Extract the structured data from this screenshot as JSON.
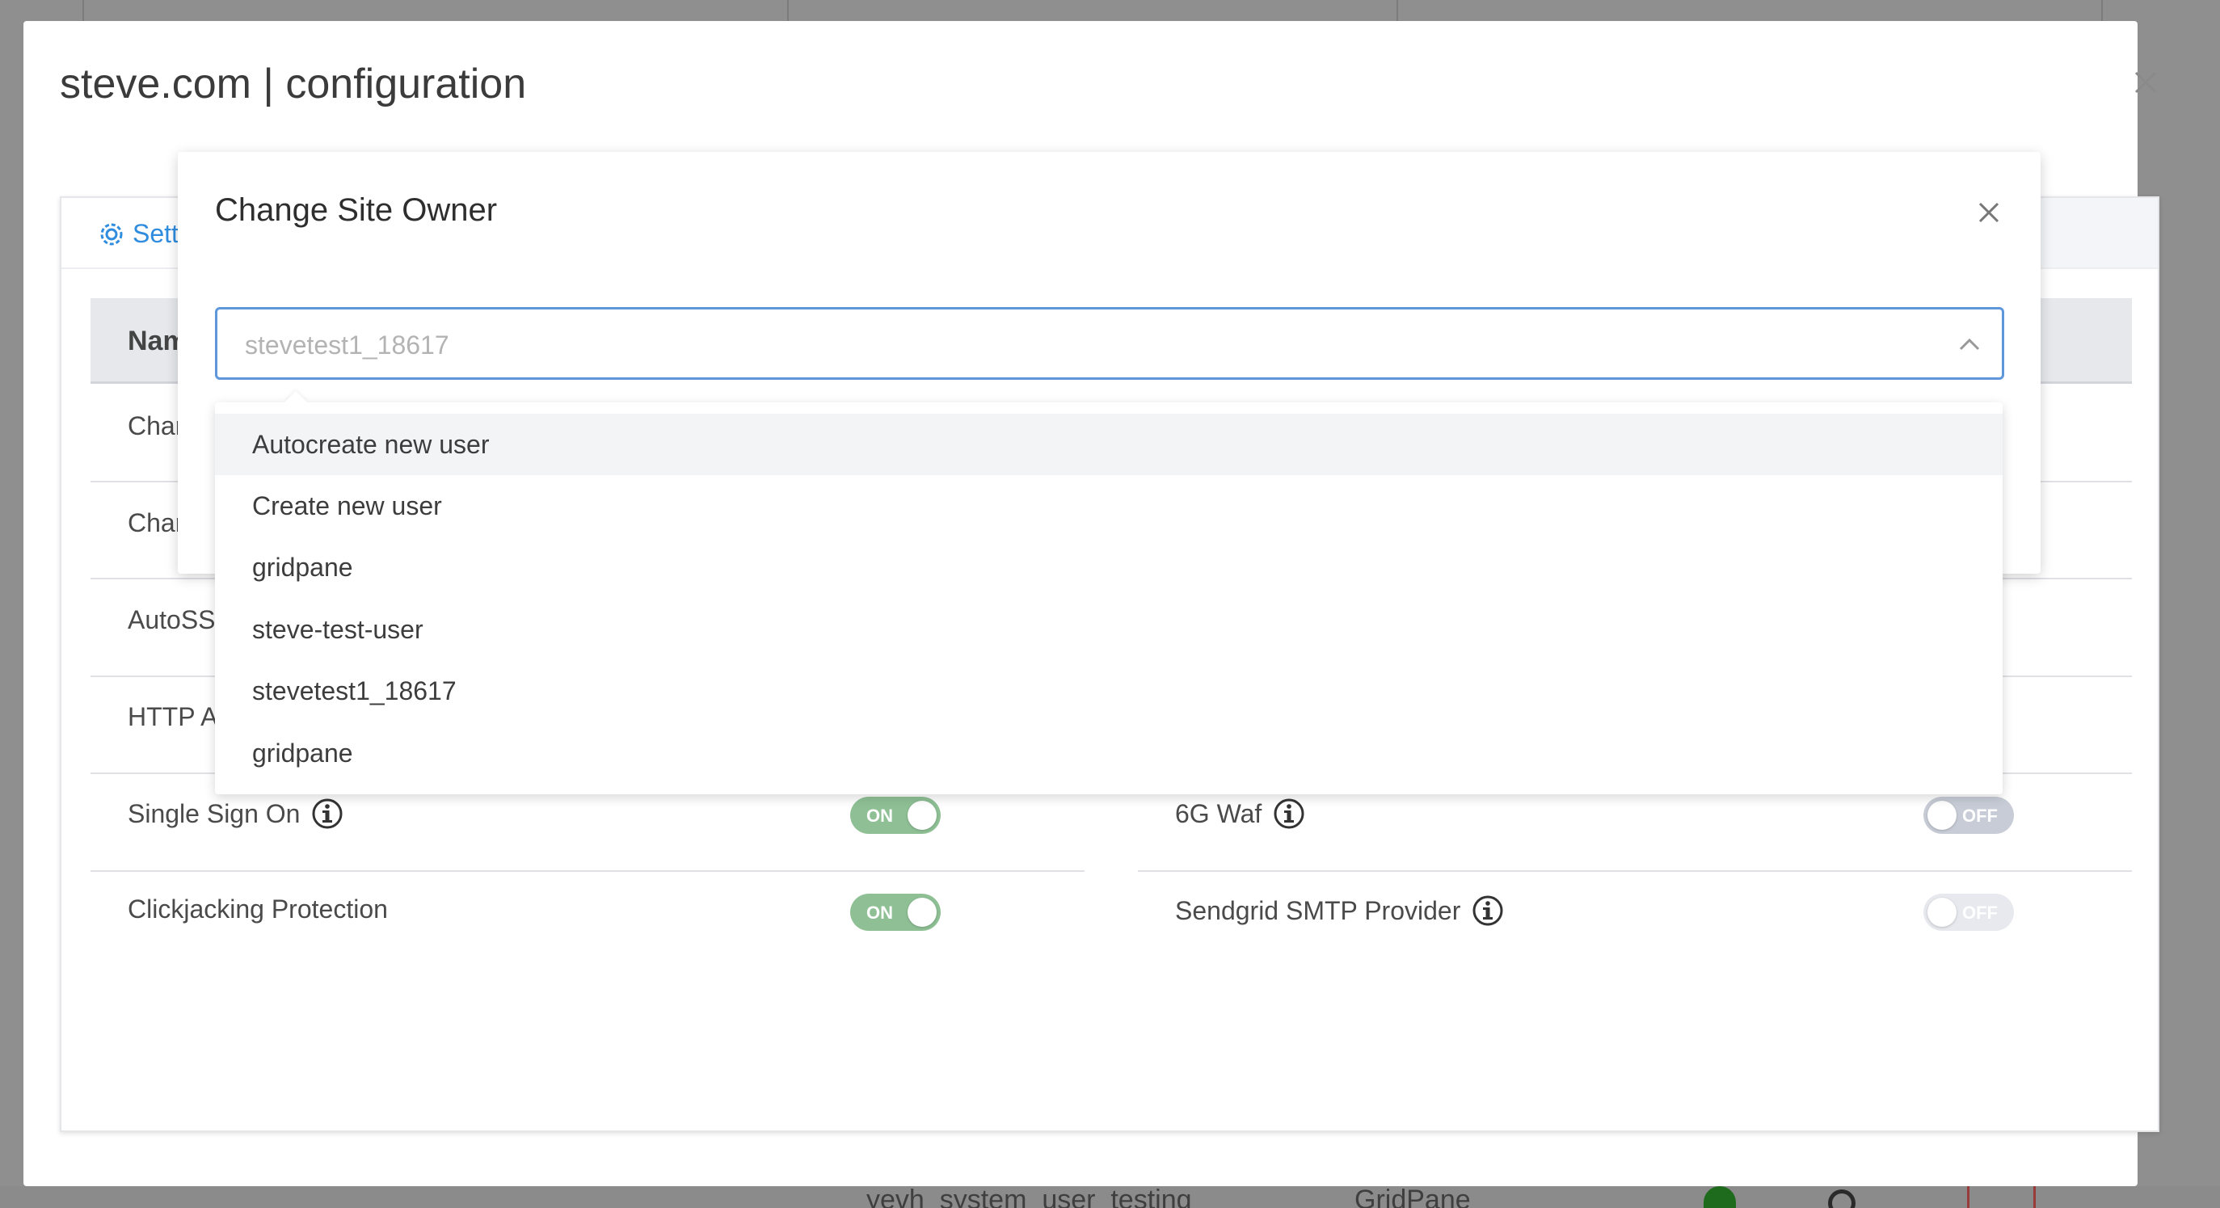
{
  "background": {
    "bottom_row": {
      "user_text": "yevh_system_user_testing",
      "provider_text": "GridPane"
    }
  },
  "config_modal": {
    "title": "steve.com | configuration",
    "close_icon": "close-icon",
    "settings_tab_label": "Setti",
    "table_header_name": "Nam",
    "rows": [
      {
        "label": "Char"
      },
      {
        "label": "Char"
      },
      {
        "label": "AutoSSL"
      },
      {
        "label": "HTTP Au"
      },
      {
        "label": "Single Sign On",
        "toggle": "ON"
      },
      {
        "label": "Clickjacking Protection",
        "toggle": "ON"
      }
    ],
    "right_rows": [
      {
        "label": "6G Waf",
        "toggle": "OFF"
      },
      {
        "label": "Sendgrid SMTP Provider",
        "toggle": "OFF"
      }
    ]
  },
  "owner_modal": {
    "title": "Change Site Owner",
    "close_icon": "close-icon",
    "select": {
      "placeholder": "stevetest1_18617",
      "chevron_icon": "chevron-up-icon"
    },
    "options": [
      "Autocreate new user",
      "Create new user",
      "gridpane",
      "steve-test-user",
      "stevetest1_18617",
      "gridpane"
    ]
  },
  "colors": {
    "accent_blue": "#2f8cde",
    "select_border": "#5e97dc",
    "toggle_on": "#8fc095",
    "toggle_off": "#e7e9ee",
    "overlay": "#8f8f8f"
  }
}
